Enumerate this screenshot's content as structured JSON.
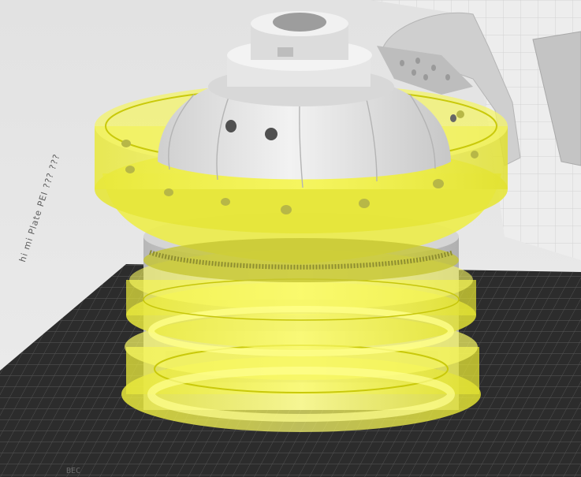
{
  "viewport": {
    "bed_label": "hi mi Plate PEI ??? ???",
    "bed_corner_label": "BEC",
    "axis_mark": "",
    "colors": {
      "background": "#e6e6e6",
      "bed": "#2a2a2a",
      "bed_grid": "#525252",
      "model": "#dcdcdc",
      "model_shadow": "#bdbdbd",
      "selection": "#f0f040",
      "selection_edge": "#c9c90a"
    }
  }
}
